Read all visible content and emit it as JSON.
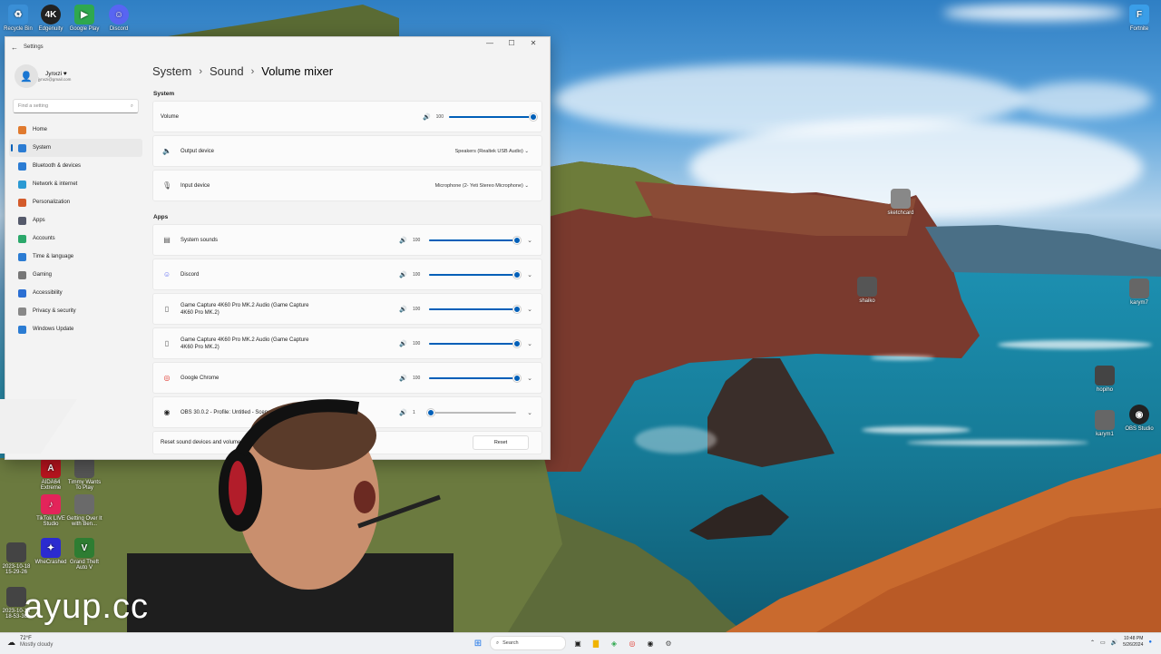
{
  "desktop": {
    "top_icons": [
      {
        "label": "Recycle Bin",
        "icon": "recycle-bin-icon",
        "color": "#3a8fd6"
      },
      {
        "label": "Edgenuity",
        "icon": "4k-icon",
        "color": "#222222",
        "glyph": "4K"
      },
      {
        "label": "Google Play",
        "icon": "google-play-icon",
        "color": "#2fa84f"
      },
      {
        "label": "Discord",
        "icon": "discord-icon",
        "color": "#5865f2"
      }
    ],
    "top_right_icon": {
      "label": "Fortnite",
      "glyph": "F",
      "color": "#3a9ee8"
    },
    "right_icons": [
      {
        "label": "sketchcard"
      },
      {
        "label": "shaiko"
      },
      {
        "label": "karym7"
      },
      {
        "label": "hopiho"
      },
      {
        "label": "karym1"
      },
      {
        "label": "OBS Studio"
      }
    ],
    "left_icons": [
      {
        "label": "AIDA64 Extreme",
        "color": "#b8141e"
      },
      {
        "label": "Timmy Wants To Play",
        "color": "#555555"
      },
      {
        "label": "TikTok LIVE Studio",
        "color": "#e3245a"
      },
      {
        "label": "Getting Over It with Ben...",
        "color": "#6a6a6a"
      },
      {
        "label": "WheCrashed",
        "color": "#2b2bd0"
      },
      {
        "label": "Grand Theft Auto V",
        "color": "#2e7d32"
      },
      {
        "label": "2023-10-18 15-29-26",
        "color": "#444444"
      },
      {
        "label": "2023-10-18 18-53-36",
        "color": "#444444"
      }
    ]
  },
  "window": {
    "title": "Settings",
    "controls": {
      "minimize": "—",
      "maximize": "☐",
      "close": "✕"
    },
    "profile": {
      "name": "Jynxzi",
      "email": "jynxzi@gmail.com"
    },
    "search_placeholder": "Find a setting",
    "nav": [
      {
        "label": "Home",
        "color": "#e07a2e",
        "selected": false
      },
      {
        "label": "System",
        "color": "#2b7cd3",
        "selected": true
      },
      {
        "label": "Bluetooth & devices",
        "color": "#2b7cd3",
        "selected": false
      },
      {
        "label": "Network & internet",
        "color": "#2b9ad3",
        "selected": false
      },
      {
        "label": "Personalization",
        "color": "#d35b2b",
        "selected": false
      },
      {
        "label": "Apps",
        "color": "#555a6b",
        "selected": false
      },
      {
        "label": "Accounts",
        "color": "#2ba86b",
        "selected": false
      },
      {
        "label": "Time & language",
        "color": "#2b7cd3",
        "selected": false
      },
      {
        "label": "Gaming",
        "color": "#777777",
        "selected": false
      },
      {
        "label": "Accessibility",
        "color": "#2b6fd3",
        "selected": false
      },
      {
        "label": "Privacy & security",
        "color": "#888888",
        "selected": false
      },
      {
        "label": "Windows Update",
        "color": "#2b7cd3",
        "selected": false
      }
    ],
    "breadcrumb": [
      "System",
      "Sound",
      "Volume mixer"
    ],
    "system_section": "System",
    "volume": {
      "label": "Volume",
      "value": "100",
      "level": 1.0
    },
    "output": {
      "label": "Output device",
      "value": "Speakers (Realtek USB Audio)"
    },
    "input": {
      "label": "Input device",
      "value": "Microphone (2- Yeti Stereo Microphone)"
    },
    "apps_section": "Apps",
    "apps": [
      {
        "label": "System sounds",
        "value": "100",
        "level": 1.0,
        "icon": "speaker-icon"
      },
      {
        "label": "Discord",
        "value": "100",
        "level": 1.0,
        "icon": "discord-icon"
      },
      {
        "label": "Game Capture 4K60 Pro MK.2 Audio (Game Capture 4K60 Pro MK.2)",
        "value": "100",
        "level": 1.0,
        "icon": "capture-icon"
      },
      {
        "label": "Game Capture 4K60 Pro MK.2 Audio (Game Capture 4K60 Pro MK.2)",
        "value": "100",
        "level": 1.0,
        "icon": "capture-icon"
      },
      {
        "label": "Google Chrome",
        "value": "100",
        "level": 1.0,
        "icon": "chrome-icon"
      },
      {
        "label": "OBS 30.0.2 - Profile: Untitled - Scenes: Untitled",
        "value": "1",
        "level": 0.01,
        "icon": "obs-icon"
      }
    ],
    "reset_label": "Reset sound devices and volumes for all apps to the recommended defaults",
    "reset_button": "Reset"
  },
  "taskbar": {
    "weather_temp": "72°F",
    "weather_desc": "Mostly cloudy",
    "search_label": "Search",
    "time": "10:48 PM",
    "date": "5/26/2024"
  },
  "watermark": "ayup.cc"
}
